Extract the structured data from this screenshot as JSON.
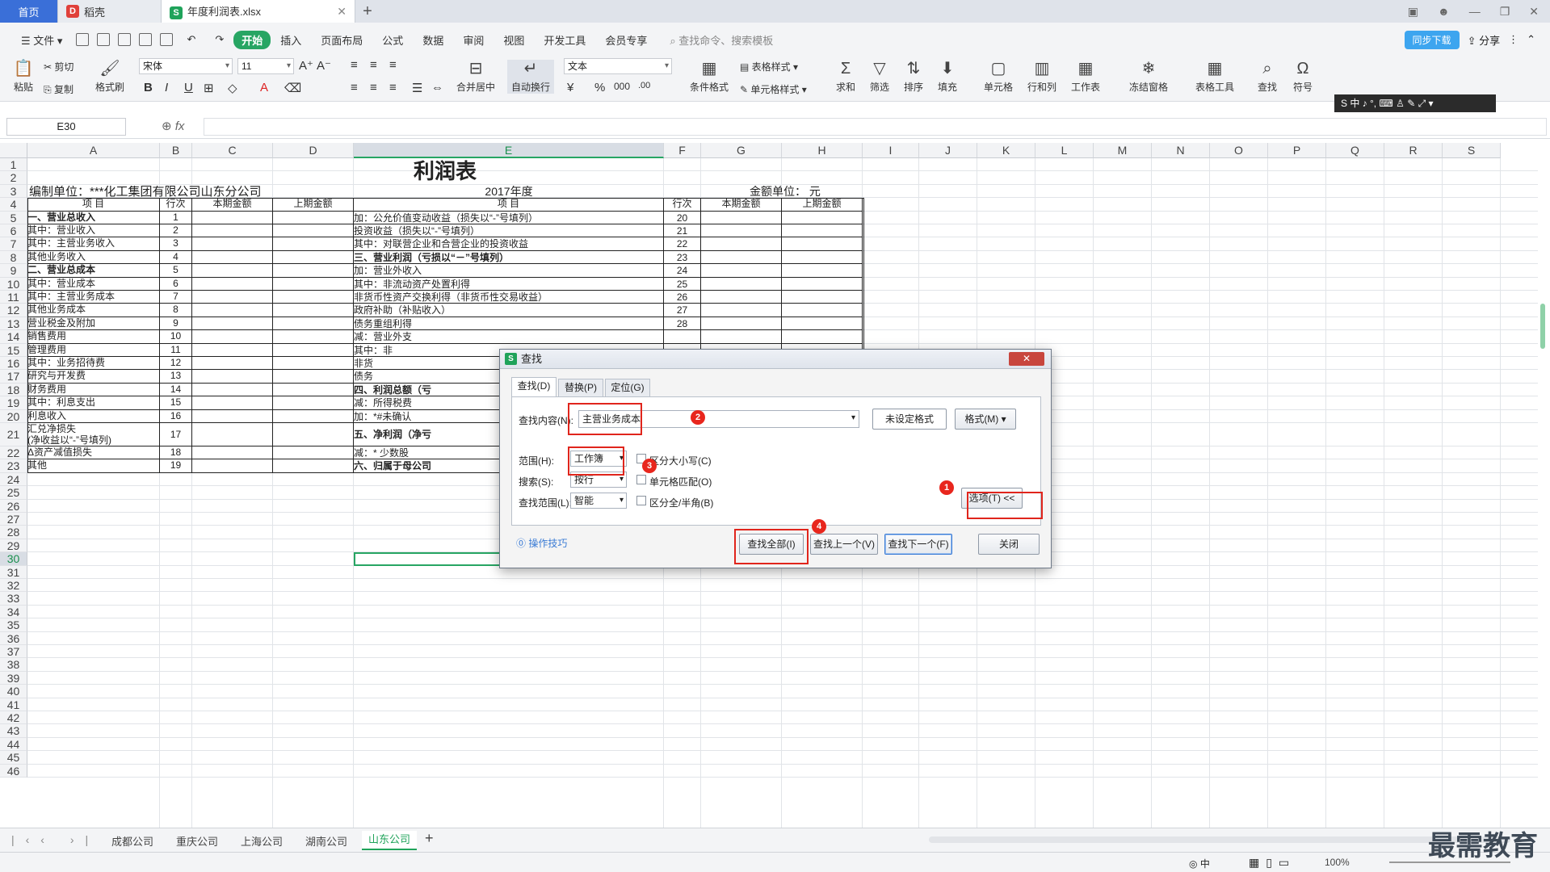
{
  "tabs": {
    "home": "首页",
    "wps": "稻壳",
    "file": "年度利润表.xlsx"
  },
  "menu": {
    "file": "文件",
    "items": [
      "开始",
      "插入",
      "页面布局",
      "公式",
      "数据",
      "审阅",
      "视图",
      "开发工具",
      "会员专享"
    ],
    "search": "查找命令、搜索模板",
    "cloud": "同步下载",
    "share": "分享"
  },
  "ribbon": {
    "paste": "粘贴",
    "cut": "剪切",
    "copy": "复制",
    "formatpainter": "格式刷",
    "font": "宋体",
    "size": "11",
    "merge": "合并居中",
    "wrap": "自动换行",
    "numfmt": "文本",
    "condfmt": "条件格式",
    "tablestyle": "表格样式",
    "cellstyle": "单元格样式",
    "sum": "求和",
    "filter": "筛选",
    "sort": "排序",
    "fill": "填充",
    "cell": "单元格",
    "rowcol": "行和列",
    "sheet": "工作表",
    "freeze": "冻结窗格",
    "tabletools": "表格工具",
    "find": "查找",
    "symbol": "符号"
  },
  "ime": "S 中 ♪ °, ⌨ ♙ ✎ ⤢ ▾",
  "formula": {
    "cellref": "E30",
    "fx": "fx"
  },
  "grid": {
    "columns": [
      "A",
      "B",
      "C",
      "D",
      "E",
      "F",
      "G",
      "H",
      "I",
      "J",
      "K",
      "L",
      "M",
      "N",
      "O",
      "P",
      "Q",
      "R",
      "S"
    ],
    "rows": [
      "1",
      "2",
      "3",
      "4",
      "5",
      "6",
      "7",
      "8",
      "9",
      "10",
      "11",
      "12",
      "13",
      "14",
      "15",
      "16",
      "17",
      "18",
      "19",
      "20",
      "21",
      "22",
      "23",
      "24",
      "25",
      "26",
      "27",
      "28",
      "29",
      "30",
      "31",
      "32",
      "33",
      "34",
      "35",
      "36",
      "37",
      "38",
      "39",
      "40",
      "41",
      "42",
      "43",
      "44",
      "45",
      "46"
    ]
  },
  "sheet": {
    "title": "利润表",
    "unit_left": "编制单位：***化工集团有限公司山东分公司",
    "year": "2017年度",
    "unit_right": "金额单位：   元",
    "hdr_item": "项          目",
    "hdr_row": "行次",
    "hdr_cur": "本期金额",
    "hdr_prev": "上期金额",
    "left": [
      [
        "一、营业总收入",
        "1"
      ],
      [
        "    其中：营业收入",
        "2"
      ],
      [
        "          其中：主营业务收入",
        "3"
      ],
      [
        "                  其他业务收入",
        "4"
      ],
      [
        "二、营业总成本",
        "5"
      ],
      [
        "    其中：营业成本",
        "6"
      ],
      [
        "              其中：主营业务成本",
        "7"
      ],
      [
        "                    其他业务成本",
        "8"
      ],
      [
        "              营业税金及附加",
        "9"
      ],
      [
        "              销售费用",
        "10"
      ],
      [
        "              管理费用",
        "11"
      ],
      [
        "                  其中：业务招待费",
        "12"
      ],
      [
        "                        研究与开发费",
        "13"
      ],
      [
        "              财务费用",
        "14"
      ],
      [
        "                  其中：利息支出",
        "15"
      ],
      [
        "                        利息收入",
        "16"
      ],
      [
        "                        汇兑净损失",
        "17"
      ],
      [
        "  (净收益以“-”号填列)",
        ""
      ],
      [
        "            Δ资产减值损失",
        "18"
      ],
      [
        "              其他",
        "19"
      ]
    ],
    "right": [
      [
        "    加：公允价值变动收益（损失以“-”号填列）",
        "20"
      ],
      [
        "          投资收益（损失以“-”号填列）",
        "21"
      ],
      [
        "              其中：对联营企业和合营企业的投资收益",
        "22"
      ],
      [
        "三、营业利润（亏损以“－”号填列）",
        "23"
      ],
      [
        "      加：营业外收入",
        "24"
      ],
      [
        "          其中：非流动资产处置利得",
        "25"
      ],
      [
        "                  非货币性资产交换利得（非货币性交易收益）",
        "26"
      ],
      [
        "                  政府补助（补贴收入）",
        "27"
      ],
      [
        "                  债务重组利得",
        "28"
      ],
      [
        "    减：营业外支",
        ""
      ],
      [
        "          其中：非",
        ""
      ],
      [
        "                  非货",
        ""
      ],
      [
        "                  债务",
        ""
      ],
      [
        "四、利润总额（亏",
        ""
      ],
      [
        "    减：所得税费",
        ""
      ],
      [
        "    加：*#未确认",
        ""
      ],
      [
        "五、净利润（净亏",
        ""
      ],
      [
        "    减：* 少数股",
        ""
      ],
      [
        "六、归属于母公司",
        ""
      ]
    ]
  },
  "dialog": {
    "title": "查找",
    "close": "✕",
    "tabs": [
      "查找(D)",
      "替换(P)",
      "定位(G)"
    ],
    "find_label": "查找内容(N):",
    "find_value": "主营业务成本",
    "noformat": "未设定格式",
    "format_btn": "格式(M)",
    "scope_label": "范围(H):",
    "scope_value": "工作簿",
    "case": "区分大小写(C)",
    "search_label": "搜索(S):",
    "search_value": "按行",
    "cellmatch": "单元格匹配(O)",
    "lookin_label": "查找范围(L):",
    "lookin_value": "智能",
    "width": "区分全/半角(B)",
    "options": "选项(T) <<",
    "tips": "操作技巧",
    "findall": "查找全部(I)",
    "findprev": "查找上一个(V)",
    "findnext": "查找下一个(F)",
    "closebtn": "关闭",
    "markers": [
      "1",
      "2",
      "3",
      "4"
    ]
  },
  "sheettabs": [
    "成都公司",
    "重庆公司",
    "上海公司",
    "湖南公司",
    "山东公司"
  ],
  "status": {
    "zoom": "100%",
    "ime": "中"
  },
  "watermark": "最需教育"
}
